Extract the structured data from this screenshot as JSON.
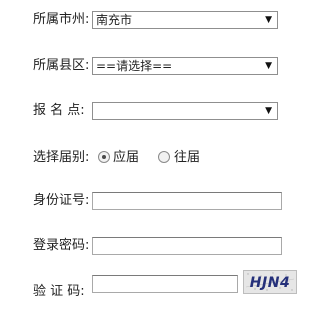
{
  "form": {
    "city": {
      "label": "所属市州:",
      "selected": "南充市"
    },
    "county": {
      "label": "所属县区:",
      "selected": "==请选择=="
    },
    "exam_site": {
      "label": "报 名 点:",
      "selected": ""
    },
    "session": {
      "label": "选择届别:",
      "options": [
        {
          "label": "应届",
          "checked": true
        },
        {
          "label": "往届",
          "checked": false
        }
      ]
    },
    "id_number": {
      "label": "身份证号:",
      "value": ""
    },
    "password": {
      "label": "登录密码:",
      "value": ""
    },
    "captcha": {
      "label": "验 证 码:",
      "value": "",
      "image_text": "HJN4"
    }
  },
  "icons": {
    "dropdown_arrow": "▼"
  }
}
